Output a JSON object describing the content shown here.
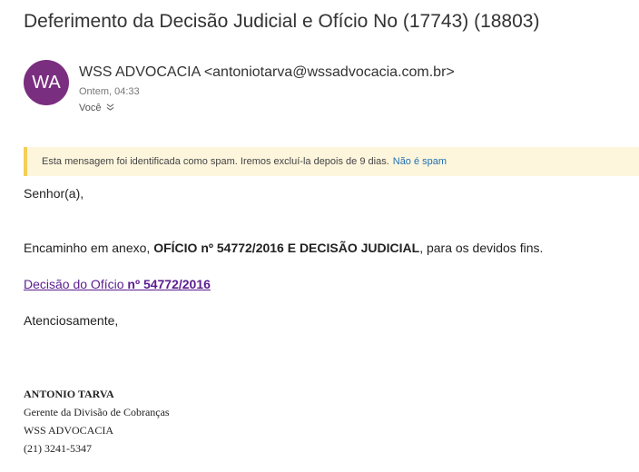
{
  "email": {
    "subject": "Deferimento da Decisão Judicial e Ofício No (17743) (18803)",
    "avatar_initials": "WA",
    "avatar_color": "#7a2e80",
    "from": "WSS ADVOCACIA <antoniotarva@wssadvocacia.com.br>",
    "date": "Ontem, 04:33",
    "recipient": "Você",
    "recipient_icon": "chevron-down-icon"
  },
  "spam_banner": {
    "message": "Esta mensagem foi identificada como spam. Iremos excluí-la depois de 9 dias.",
    "action": "Não é spam",
    "accent_color": "#f4cf55"
  },
  "body": {
    "greeting": "Senhor(a),",
    "line_prefix": "Encaminho em anexo, ",
    "line_bold": "OFÍCIO nº 54772/2016 E DECISÃO JUDICIAL",
    "line_suffix": ", para os devidos fins.",
    "link_prefix": "Decisão do Ofício ",
    "link_bold": "nº 54772/2016",
    "closing": "Atenciosamente,"
  },
  "signature": {
    "name": "ANTONIO TARVA",
    "role": "Gerente da Divisão de Cobranças",
    "company": "WSS ADVOCACIA",
    "phone": "(21) 3241-5347"
  }
}
